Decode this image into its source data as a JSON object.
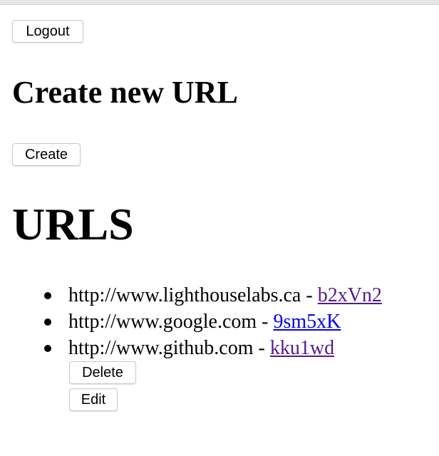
{
  "header": {
    "logout_label": "Logout"
  },
  "create_section": {
    "title": "Create new URL",
    "create_label": "Create"
  },
  "urls_section": {
    "title": "URLS",
    "separator": " - ",
    "items": [
      {
        "long_url": "http://www.lighthouselabs.ca",
        "short_code": "b2xVn2",
        "link_color": "#551a8b"
      },
      {
        "long_url": "http://www.google.com",
        "short_code": "9sm5xK",
        "link_color": "#0000ee"
      },
      {
        "long_url": "http://www.github.com",
        "short_code": "kku1wd",
        "link_color": "#551a8b"
      }
    ],
    "delete_label": "Delete",
    "edit_label": "Edit"
  }
}
